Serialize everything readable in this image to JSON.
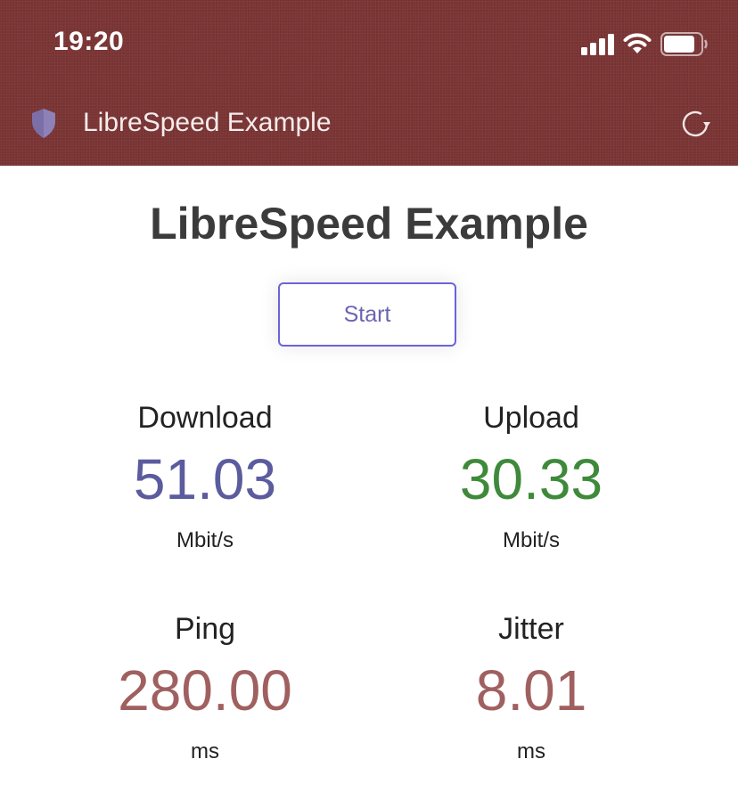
{
  "status_bar": {
    "time": "19:20",
    "icons": [
      "signal-icon",
      "wifi-icon",
      "battery-icon"
    ]
  },
  "nav_bar": {
    "title": "LibreSpeed Example",
    "left_icon": "shield-icon",
    "right_icon": "reload-icon",
    "background_color": "#7a3434"
  },
  "main": {
    "title": "LibreSpeed Example",
    "start_button_label": "Start",
    "metrics": {
      "download": {
        "label": "Download",
        "value": "51.03",
        "unit": "Mbit/s",
        "color": "#5b5b9e"
      },
      "upload": {
        "label": "Upload",
        "value": "30.33",
        "unit": "Mbit/s",
        "color": "#3e8a3a"
      },
      "ping": {
        "label": "Ping",
        "value": "280.00",
        "unit": "ms",
        "color": "#a06060"
      },
      "jitter": {
        "label": "Jitter",
        "value": "8.01",
        "unit": "ms",
        "color": "#a06060"
      }
    }
  }
}
